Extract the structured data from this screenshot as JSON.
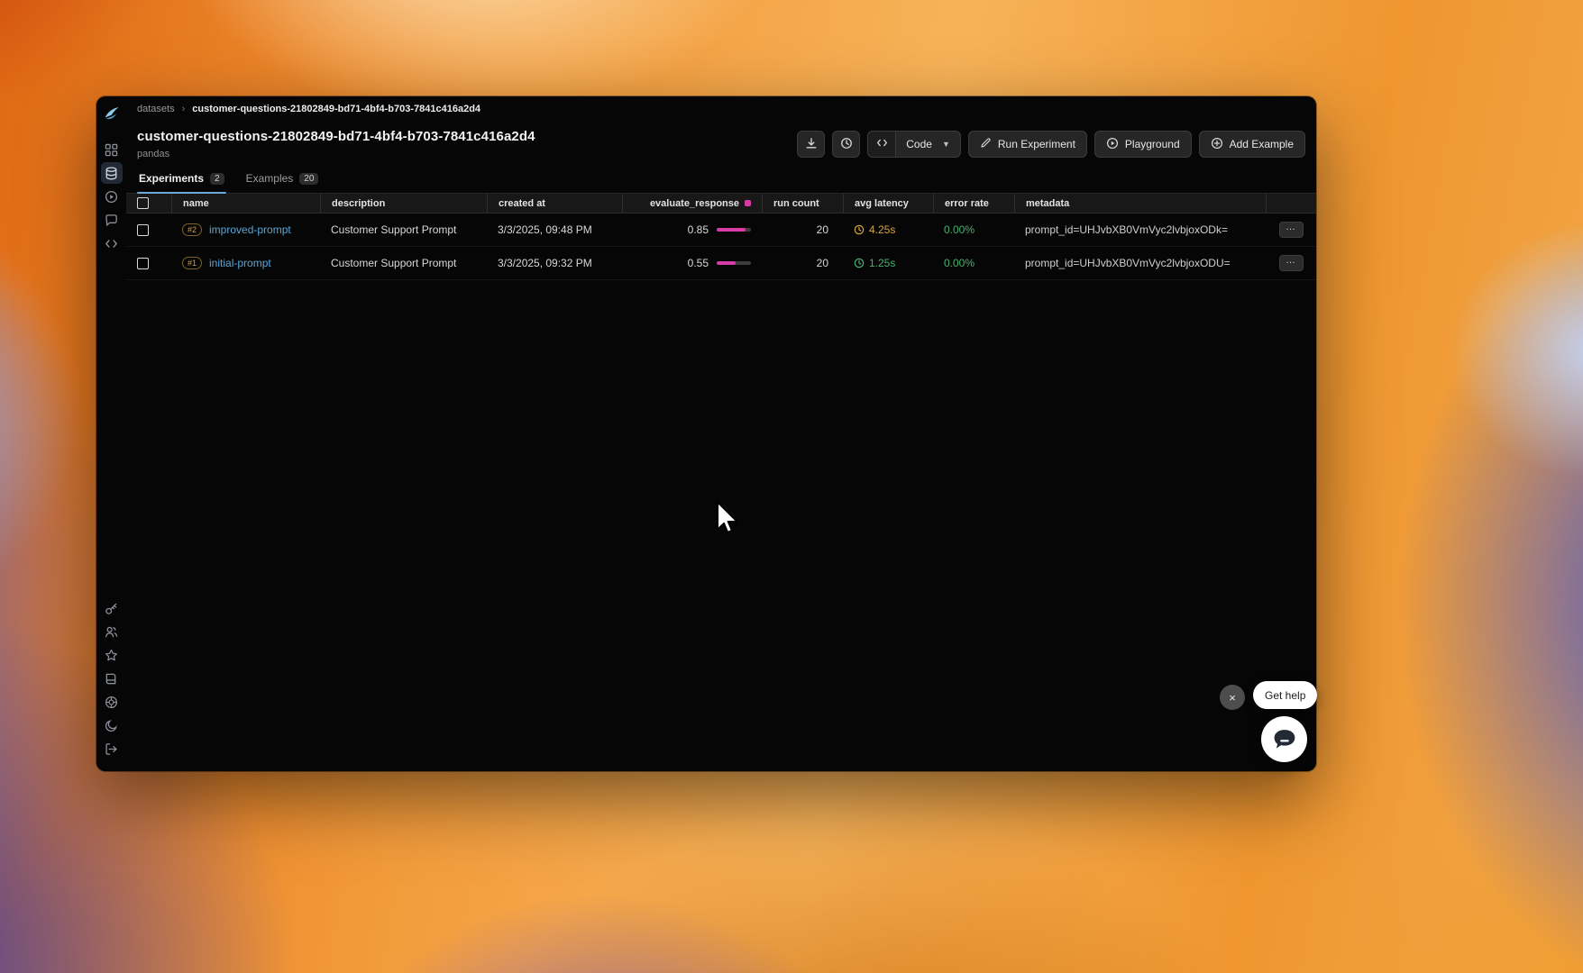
{
  "breadcrumb": {
    "root": "datasets",
    "separator": "›",
    "current": "customer-questions-21802849-bd71-4bf4-b703-7841c416a2d4"
  },
  "header": {
    "title": "customer-questions-21802849-bd71-4bf4-b703-7841c416a2d4",
    "subtitle": "pandas"
  },
  "toolbar": {
    "code_label": "Code",
    "run_experiment_label": "Run Experiment",
    "playground_label": "Playground",
    "add_example_label": "Add Example"
  },
  "tabs": {
    "experiments_label": "Experiments",
    "experiments_count": "2",
    "examples_label": "Examples",
    "examples_count": "20"
  },
  "table": {
    "columns": {
      "name": "name",
      "description": "description",
      "created_at": "created at",
      "evaluate_response": "evaluate_response",
      "run_count": "run count",
      "avg_latency": "avg latency",
      "error_rate": "error rate",
      "metadata": "metadata"
    },
    "rows": [
      {
        "badge": "#2",
        "name": "improved-prompt",
        "description": "Customer Support Prompt",
        "created_at": "3/3/2025, 09:48 PM",
        "evaluate_response": "0.85",
        "evaluate_bar_width": "85%",
        "run_count": "20",
        "avg_latency": "4.25s",
        "latency_color": "#d9a43e",
        "error_rate": "0.00%",
        "metadata": "prompt_id=UHJvbXB0VmVyc2lvbjoxODk="
      },
      {
        "badge": "#1",
        "name": "initial-prompt",
        "description": "Customer Support Prompt",
        "created_at": "3/3/2025, 09:32 PM",
        "evaluate_response": "0.55",
        "evaluate_bar_width": "55%",
        "run_count": "20",
        "avg_latency": "1.25s",
        "latency_color": "#49b16d",
        "error_rate": "0.00%",
        "metadata": "prompt_id=UHJvbXB0VmVyc2lvbjoxODU="
      }
    ]
  },
  "help": {
    "get_help_label": "Get help",
    "close_label": "×"
  },
  "icons": {
    "sidebar_top": [
      "phoenix-logo",
      "grid",
      "database",
      "play-circle",
      "chat-bubble",
      "code-brackets"
    ],
    "sidebar_bottom": [
      "key",
      "users",
      "star",
      "book",
      "lifebuoy",
      "moon",
      "logout"
    ],
    "toolbar": [
      "download",
      "history-clock",
      "code-brackets",
      "pencil",
      "play-circle",
      "plus-circle",
      "chevron-down"
    ],
    "status": [
      "clock",
      "pink-dot",
      "more-ellipsis"
    ]
  },
  "colors": {
    "accent_pink": "#d93ba6",
    "link_blue": "#58a6d6",
    "status_green": "#49b16d",
    "status_amber": "#d9a43e"
  }
}
